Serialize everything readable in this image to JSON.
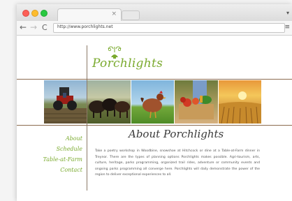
{
  "browser": {
    "tab_close": "×",
    "url": "http://www.porchlights.net",
    "back_glyph": "←",
    "forward_glyph": "→",
    "reload_glyph": "C",
    "menu_glyph": "≡",
    "tabs_overflow_glyph": "▾"
  },
  "site": {
    "logo_text": "Porchlights",
    "nav": [
      "About",
      "Schedule",
      "Table-at-Farm",
      "Contact"
    ],
    "heading": "About Porchlights",
    "paragraph": "Take a poetry workshop in Woodbine, snowshoe at Hitchcock or dine at a Table-at-Farm dinner in Treynor. There are the types of planning options Porchlights makes possible. Agri-tourism, arts, culture, heritage, parks programming, organized trail rides, adventure or community events and ongoing parks programming all converge here. Porchlights will daily demonstrate the power of the region to deliver exceptional experiences to all."
  },
  "colors": {
    "accent_green": "#7aaa2e",
    "rule_brown": "#8b6b4f"
  },
  "icons": {
    "logo": "porch-lamp-icon",
    "menu": "hamburger-menu-icon"
  }
}
